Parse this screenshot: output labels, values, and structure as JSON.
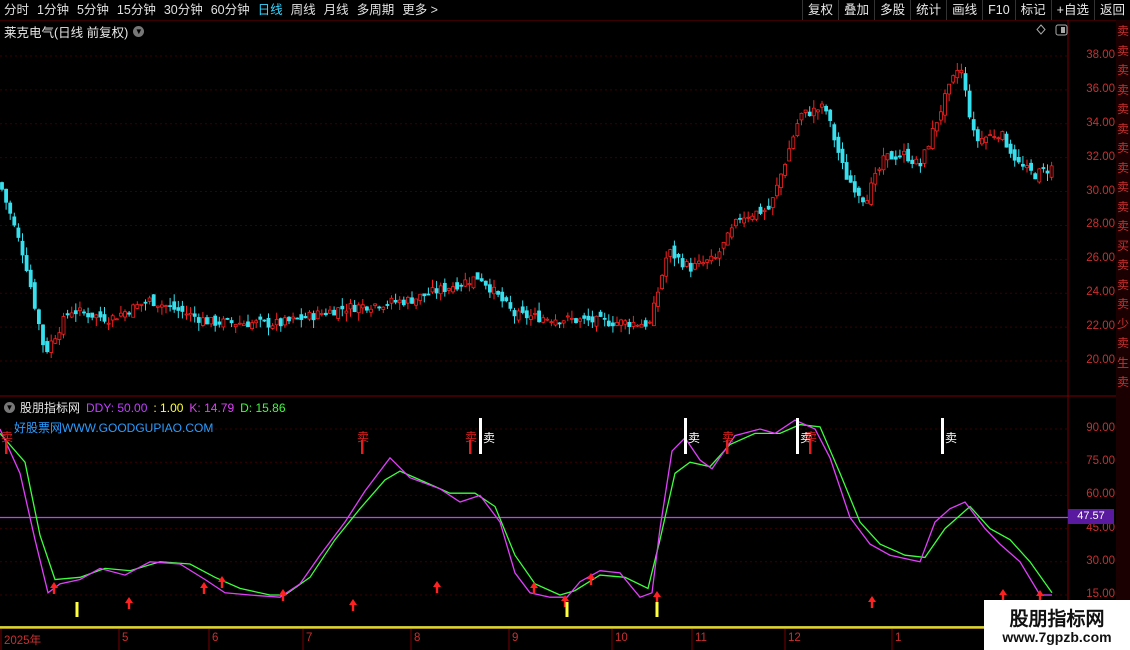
{
  "toolbar": {
    "periods": [
      "分时",
      "1分钟",
      "5分钟",
      "15分钟",
      "30分钟",
      "60分钟",
      "日线",
      "周线",
      "月线",
      "多周期",
      "更多 >"
    ],
    "active_period": "日线",
    "right_buttons": [
      "复权",
      "叠加",
      "多股",
      "统计",
      "画线",
      "F10",
      "标记",
      "+自选",
      "返回"
    ]
  },
  "stock": {
    "title": "莱克电气(日线 前复权)"
  },
  "indicator": {
    "name": "股朋指标网",
    "ddy": "DDY: 50.00",
    "one": ": 1.00",
    "k": "K: 14.79",
    "d": "D: 15.86",
    "watermark": "好股票网WWW.GOODGUPIAO.COM",
    "value_tag": "47.57",
    "sell_label": "卖",
    "colors": {
      "k": "#e040fb",
      "d": "#3cff3c",
      "ddy": "#c040ff",
      "one": "#ffff40",
      "sell_red": "#e02020",
      "sell_white": "#ffffff",
      "up": "#ff2020",
      "down": "#37e0ee"
    }
  },
  "price_axis": [
    "38.00",
    "36.00",
    "34.00",
    "32.00",
    "30.00",
    "28.00",
    "26.00",
    "24.00",
    "22.00",
    "20.00"
  ],
  "ind_axis": [
    "90.00",
    "75.00",
    "60.00",
    "45.00",
    "30.00",
    "15.00"
  ],
  "date_axis": [
    "2025年",
    "5",
    "6",
    "7",
    "8",
    "9",
    "10",
    "11",
    "12",
    "1"
  ],
  "side_chars": [
    "卖",
    "卖",
    "卖",
    "卖",
    "卖",
    "卖",
    "卖",
    "卖",
    "卖",
    "卖",
    "卖",
    "买",
    "卖",
    "卖",
    "卖",
    "少",
    "卖",
    "生",
    "卖"
  ],
  "logo": {
    "line1": "股朋指标网",
    "line2": "www.7gpzb.com"
  },
  "chart_data": [
    {
      "type": "candlestick",
      "title": "莱克电气(日线 前复权)",
      "ylim": [
        19,
        39
      ],
      "close_key_points": [
        {
          "x": 0,
          "y": 30.5
        },
        {
          "x": 25,
          "y": 26.0
        },
        {
          "x": 45,
          "y": 20.5
        },
        {
          "x": 70,
          "y": 23.0
        },
        {
          "x": 110,
          "y": 22.5
        },
        {
          "x": 150,
          "y": 23.6
        },
        {
          "x": 210,
          "y": 22.3
        },
        {
          "x": 280,
          "y": 22.2
        },
        {
          "x": 340,
          "y": 23.1
        },
        {
          "x": 410,
          "y": 23.6
        },
        {
          "x": 480,
          "y": 25.0
        },
        {
          "x": 515,
          "y": 22.7
        },
        {
          "x": 580,
          "y": 22.4
        },
        {
          "x": 650,
          "y": 22.2
        },
        {
          "x": 668,
          "y": 26.5
        },
        {
          "x": 690,
          "y": 25.5
        },
        {
          "x": 715,
          "y": 26.0
        },
        {
          "x": 740,
          "y": 28.5
        },
        {
          "x": 770,
          "y": 29.0
        },
        {
          "x": 800,
          "y": 34.5
        },
        {
          "x": 825,
          "y": 35.0
        },
        {
          "x": 845,
          "y": 31.0
        },
        {
          "x": 865,
          "y": 29.5
        },
        {
          "x": 885,
          "y": 32.0
        },
        {
          "x": 905,
          "y": 32.2
        },
        {
          "x": 920,
          "y": 31.5
        },
        {
          "x": 945,
          "y": 35.5
        },
        {
          "x": 960,
          "y": 37.5
        },
        {
          "x": 975,
          "y": 33.0
        },
        {
          "x": 1000,
          "y": 33.5
        },
        {
          "x": 1020,
          "y": 31.5
        },
        {
          "x": 1035,
          "y": 31.0
        },
        {
          "x": 1055,
          "y": 31.5
        }
      ]
    },
    {
      "type": "line",
      "title": "股朋指标网",
      "ylim": [
        10,
        100
      ],
      "series": [
        {
          "name": "DDY",
          "values": [
            50,
            50
          ]
        },
        {
          "name": "K",
          "points": [
            {
              "x": 0,
              "y": 90
            },
            {
              "x": 20,
              "y": 70
            },
            {
              "x": 35,
              "y": 40
            },
            {
              "x": 48,
              "y": 16
            },
            {
              "x": 60,
              "y": 20
            },
            {
              "x": 80,
              "y": 22
            },
            {
              "x": 100,
              "y": 27
            },
            {
              "x": 125,
              "y": 24
            },
            {
              "x": 150,
              "y": 30
            },
            {
              "x": 180,
              "y": 29
            },
            {
              "x": 205,
              "y": 22
            },
            {
              "x": 225,
              "y": 16
            },
            {
              "x": 250,
              "y": 15
            },
            {
              "x": 280,
              "y": 14
            },
            {
              "x": 300,
              "y": 20
            },
            {
              "x": 320,
              "y": 33
            },
            {
              "x": 345,
              "y": 48
            },
            {
              "x": 365,
              "y": 62
            },
            {
              "x": 390,
              "y": 77
            },
            {
              "x": 410,
              "y": 68
            },
            {
              "x": 440,
              "y": 63
            },
            {
              "x": 460,
              "y": 57
            },
            {
              "x": 480,
              "y": 60
            },
            {
              "x": 500,
              "y": 48
            },
            {
              "x": 515,
              "y": 25
            },
            {
              "x": 530,
              "y": 16
            },
            {
              "x": 550,
              "y": 14
            },
            {
              "x": 567,
              "y": 14
            },
            {
              "x": 580,
              "y": 21
            },
            {
              "x": 600,
              "y": 26
            },
            {
              "x": 620,
              "y": 25
            },
            {
              "x": 640,
              "y": 14
            },
            {
              "x": 652,
              "y": 16
            },
            {
              "x": 660,
              "y": 45
            },
            {
              "x": 672,
              "y": 80
            },
            {
              "x": 685,
              "y": 86
            },
            {
              "x": 700,
              "y": 76
            },
            {
              "x": 712,
              "y": 72
            },
            {
              "x": 735,
              "y": 87
            },
            {
              "x": 760,
              "y": 90
            },
            {
              "x": 775,
              "y": 88
            },
            {
              "x": 795,
              "y": 94
            },
            {
              "x": 815,
              "y": 90
            },
            {
              "x": 830,
              "y": 77
            },
            {
              "x": 850,
              "y": 50
            },
            {
              "x": 870,
              "y": 38
            },
            {
              "x": 890,
              "y": 33
            },
            {
              "x": 910,
              "y": 31
            },
            {
              "x": 920,
              "y": 30
            },
            {
              "x": 935,
              "y": 48
            },
            {
              "x": 950,
              "y": 54
            },
            {
              "x": 965,
              "y": 57
            },
            {
              "x": 985,
              "y": 45
            },
            {
              "x": 1000,
              "y": 38
            },
            {
              "x": 1020,
              "y": 30
            },
            {
              "x": 1040,
              "y": 15
            },
            {
              "x": 1052,
              "y": 15
            }
          ]
        },
        {
          "name": "D",
          "points": [
            {
              "x": 0,
              "y": 88
            },
            {
              "x": 25,
              "y": 75
            },
            {
              "x": 40,
              "y": 42
            },
            {
              "x": 55,
              "y": 22
            },
            {
              "x": 80,
              "y": 23
            },
            {
              "x": 105,
              "y": 27
            },
            {
              "x": 130,
              "y": 26
            },
            {
              "x": 160,
              "y": 30
            },
            {
              "x": 190,
              "y": 29
            },
            {
              "x": 215,
              "y": 23
            },
            {
              "x": 240,
              "y": 18
            },
            {
              "x": 270,
              "y": 15
            },
            {
              "x": 285,
              "y": 15
            },
            {
              "x": 310,
              "y": 23
            },
            {
              "x": 335,
              "y": 40
            },
            {
              "x": 360,
              "y": 54
            },
            {
              "x": 385,
              "y": 67
            },
            {
              "x": 400,
              "y": 71
            },
            {
              "x": 425,
              "y": 66
            },
            {
              "x": 450,
              "y": 61
            },
            {
              "x": 475,
              "y": 61
            },
            {
              "x": 495,
              "y": 55
            },
            {
              "x": 515,
              "y": 33
            },
            {
              "x": 535,
              "y": 20
            },
            {
              "x": 560,
              "y": 15
            },
            {
              "x": 575,
              "y": 17
            },
            {
              "x": 600,
              "y": 24
            },
            {
              "x": 625,
              "y": 23
            },
            {
              "x": 648,
              "y": 18
            },
            {
              "x": 660,
              "y": 40
            },
            {
              "x": 675,
              "y": 70
            },
            {
              "x": 690,
              "y": 75
            },
            {
              "x": 710,
              "y": 73
            },
            {
              "x": 730,
              "y": 83
            },
            {
              "x": 755,
              "y": 88
            },
            {
              "x": 780,
              "y": 88
            },
            {
              "x": 800,
              "y": 92
            },
            {
              "x": 820,
              "y": 91
            },
            {
              "x": 840,
              "y": 70
            },
            {
              "x": 860,
              "y": 48
            },
            {
              "x": 880,
              "y": 38
            },
            {
              "x": 905,
              "y": 33
            },
            {
              "x": 925,
              "y": 32
            },
            {
              "x": 945,
              "y": 45
            },
            {
              "x": 970,
              "y": 55
            },
            {
              "x": 990,
              "y": 45
            },
            {
              "x": 1010,
              "y": 40
            },
            {
              "x": 1030,
              "y": 30
            },
            {
              "x": 1052,
              "y": 16
            }
          ]
        }
      ],
      "sell_signals": [
        {
          "x": 6,
          "color": "red"
        },
        {
          "x": 362,
          "color": "red"
        },
        {
          "x": 470,
          "color": "red"
        },
        {
          "x": 480,
          "color": "white"
        },
        {
          "x": 685,
          "color": "white"
        },
        {
          "x": 727,
          "color": "red"
        },
        {
          "x": 797,
          "color": "white"
        },
        {
          "x": 810,
          "color": "red"
        },
        {
          "x": 942,
          "color": "white"
        }
      ],
      "buy_arrows": [
        54,
        129,
        204,
        222,
        283,
        353,
        437,
        534,
        565,
        591,
        657,
        872,
        1003,
        1040
      ],
      "yellow_bars": [
        77,
        567,
        657
      ]
    }
  ]
}
